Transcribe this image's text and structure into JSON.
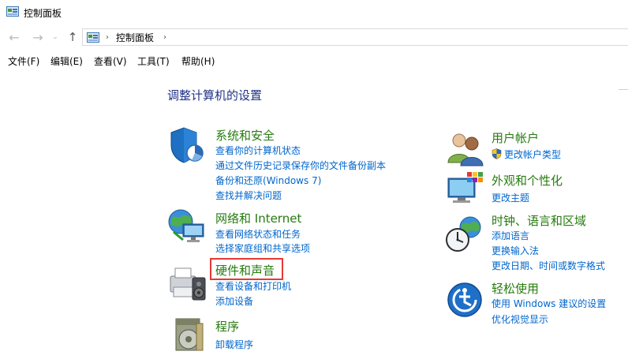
{
  "window": {
    "title": "控制面板"
  },
  "nav": {
    "back_glyph": "←",
    "forward_glyph": "→",
    "dropdown_glyph": "⌄",
    "up_glyph": "↑",
    "breadcrumb_sep": "›",
    "breadcrumb": "控制面板"
  },
  "menu": {
    "file": "文件(F)",
    "edit": "编辑(E)",
    "view": "查看(V)",
    "tools": "工具(T)",
    "help": "帮助(H)"
  },
  "main": {
    "title": "调整计算机的设置",
    "left": {
      "system": {
        "title": "系统和安全",
        "links": [
          "查看你的计算机状态",
          "通过文件历史记录保存你的文件备份副本",
          "备份和还原(Windows 7)",
          "查找并解决问题"
        ]
      },
      "network": {
        "title": "网络和 Internet",
        "links": [
          "查看网络状态和任务",
          "选择家庭组和共享选项"
        ]
      },
      "hardware": {
        "title": "硬件和声音",
        "links": [
          "查看设备和打印机",
          "添加设备"
        ]
      },
      "programs": {
        "title": "程序",
        "links": [
          "卸载程序"
        ]
      }
    },
    "right": {
      "users": {
        "title": "用户帐户",
        "links": [
          "更改帐户类型"
        ]
      },
      "appearance": {
        "title": "外观和个性化",
        "links": [
          "更改主题"
        ]
      },
      "clock": {
        "title": "时钟、语言和区域",
        "links": [
          "添加语言",
          "更换输入法",
          "更改日期、时间或数字格式"
        ]
      },
      "ease": {
        "title": "轻松使用",
        "links": [
          "使用 Windows 建议的设置",
          "优化视觉显示"
        ]
      }
    }
  },
  "colors": {
    "category_title": "#267b0f",
    "link": "#0066cc",
    "page_title": "#1e3287",
    "highlight": "#e53935"
  },
  "icons": {
    "window": "control-panel-icon",
    "system": "shield-icon",
    "network": "network-globe-icon",
    "hardware": "printer-speaker-icon",
    "programs": "program-disc-icon",
    "users": "users-icon",
    "appearance": "monitor-palette-icon",
    "clock": "clock-globe-icon",
    "ease": "ease-of-access-icon",
    "uac": "uac-shield-icon"
  }
}
